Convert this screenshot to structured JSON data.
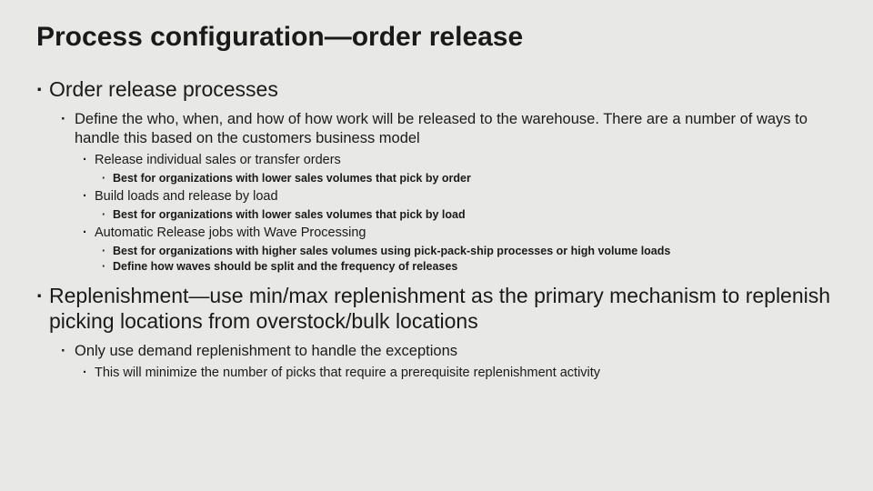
{
  "title": "Process configuration—order release",
  "bullets": {
    "b1": "Order release processes",
    "b1_1": "Define the who, when, and how of how work will be released to the warehouse.  There are a number of ways to handle this based on the customers business model",
    "b1_1_1": "Release individual sales or transfer orders",
    "b1_1_1_1": "Best for organizations with lower sales volumes that pick by order",
    "b1_1_2": "Build loads and release by load",
    "b1_1_2_1": "Best for organizations with lower sales volumes that pick by load",
    "b1_1_3": "Automatic Release jobs with Wave Processing",
    "b1_1_3_1": "Best for organizations with higher sales volumes using pick-pack-ship processes or high volume loads",
    "b1_1_3_2": "Define how waves should be split and the frequency of releases",
    "b2": "Replenishment—use min/max replenishment as the primary mechanism to replenish picking locations from overstock/bulk locations",
    "b2_1": "Only use demand replenishment to handle the exceptions",
    "b2_1_1": "This will minimize the number of picks that require a prerequisite replenishment activity"
  }
}
